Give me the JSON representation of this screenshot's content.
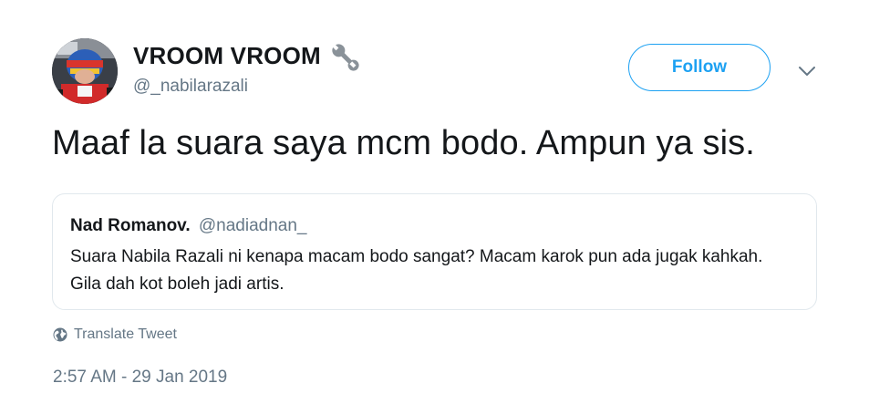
{
  "author": {
    "display_name": "VROOM VROOM",
    "handle": "@_nabilarazali",
    "badge_icon": "wrench-icon",
    "avatar_icon": "avatar-photo"
  },
  "actions": {
    "follow_label": "Follow",
    "more_icon": "chevron-down-icon"
  },
  "tweet": {
    "text": "Maaf la suara saya mcm bodo. Ampun ya sis.",
    "translate_label": "Translate Tweet",
    "timestamp": "2:57 AM - 29 Jan 2019"
  },
  "quoted_tweet": {
    "display_name": "Nad Romanov.",
    "handle": "@nadiadnan_",
    "text": "Suara Nabila Razali ni kenapa macam bodo sangat? Macam karok pun ada jugak kahkah. Gila dah kot boleh jadi artis."
  },
  "colors": {
    "accent": "#1da1f2",
    "text_primary": "#14171a",
    "text_secondary": "#657786",
    "border": "#e1e8ed"
  }
}
